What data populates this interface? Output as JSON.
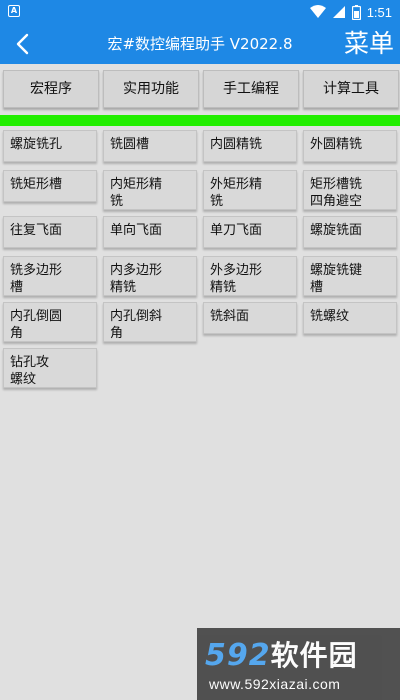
{
  "status_bar": {
    "notification_icon": "A",
    "time": "1:51",
    "icons": [
      "wifi-icon",
      "signal-icon",
      "battery-icon"
    ]
  },
  "app_bar": {
    "title": "宏#数控编程助手 V2022.8",
    "menu_label": "菜单",
    "color": "#1e88e5"
  },
  "tabs": [
    {
      "label": "宏程序"
    },
    {
      "label": "实用功能"
    },
    {
      "label": "手工编程"
    },
    {
      "label": "计算工具"
    }
  ],
  "accent_bar_color": "#22ee00",
  "buttons": [
    {
      "label": "螺旋铣孔"
    },
    {
      "label": "铣圆槽"
    },
    {
      "label": "内圆精铣"
    },
    {
      "label": "外圆精铣"
    },
    {
      "label": "铣矩形槽"
    },
    {
      "label": "内矩形精\n铣"
    },
    {
      "label": "外矩形精\n铣"
    },
    {
      "label": "矩形槽铣\n四角避空"
    },
    {
      "label": "往复飞面"
    },
    {
      "label": "单向飞面"
    },
    {
      "label": "单刀飞面"
    },
    {
      "label": "螺旋铣面"
    },
    {
      "label": "铣多边形\n槽"
    },
    {
      "label": "内多边形\n精铣"
    },
    {
      "label": "外多边形\n精铣"
    },
    {
      "label": "螺旋铣键\n槽"
    },
    {
      "label": "内孔倒圆\n角"
    },
    {
      "label": "内孔倒斜\n角"
    },
    {
      "label": "铣斜面"
    },
    {
      "label": "铣螺纹"
    },
    {
      "label": "钻孔攻\n螺纹"
    }
  ],
  "watermark": {
    "logo_num": "592",
    "logo_text": "软件园",
    "url": "www.592xiazai.com"
  }
}
